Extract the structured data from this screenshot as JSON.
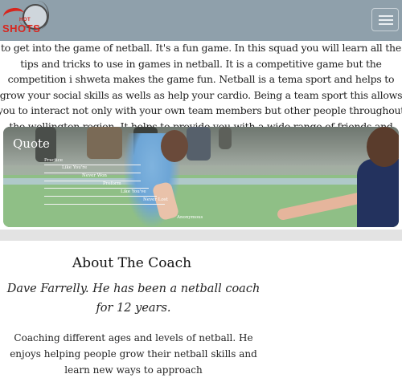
{
  "header": {
    "logo_small_text": "HOT",
    "logo_text": "SHOTS",
    "brand_color": "#d7261e",
    "menu_icon": "hamburger-menu-icon"
  },
  "intro": {
    "text": "to get into the game of netball. It's a fun game. In this squad you will learn all the tips and tricks to use in games in netball. It is a competitive game but the competition i shweta makes the game fun. Netball is a tema sport and helps to grow your social skills as wells as help your cardio. Being a team sport this allows you to interact not only with your own team members but other people throughout the wellington region. It helps to provide you with a wide range of friends and helps you gain more social confidence."
  },
  "quote": {
    "title": "Quote",
    "words": [
      "Practice",
      "Like You're",
      "Never Won",
      "Preform",
      "Like You've",
      "Never Lost"
    ],
    "author": "Anonymous"
  },
  "about": {
    "title": "About The Coach",
    "subtitle": "Dave Farrelly. He has been a netball coach for 12 years.",
    "body": "Coaching different ages and levels of netball. He enjoys helping people grow their netball skills and learn new ways to approach"
  }
}
